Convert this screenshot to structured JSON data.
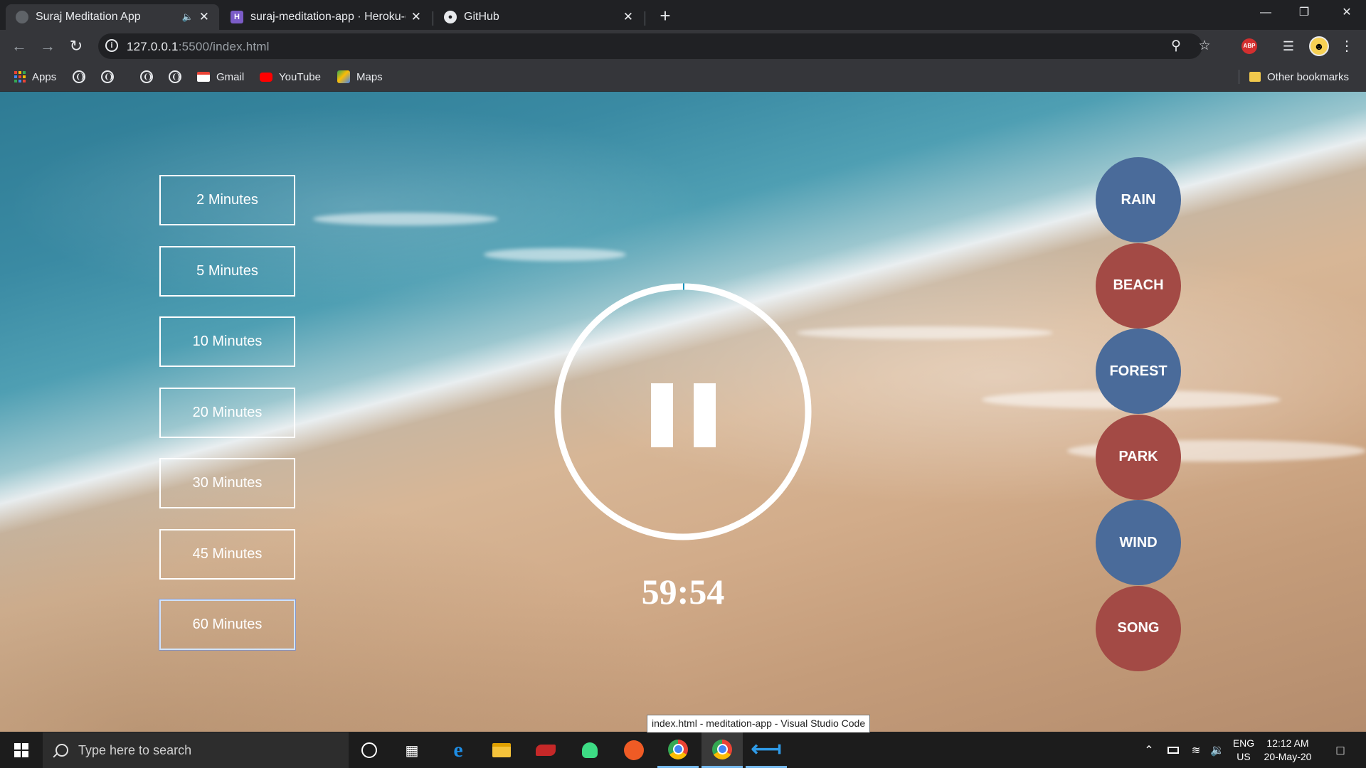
{
  "browser": {
    "tabs": [
      {
        "title": "Suraj Meditation App",
        "active": true,
        "audio": true
      },
      {
        "title": "suraj-meditation-app · Heroku-g",
        "active": false
      },
      {
        "title": "GitHub",
        "active": false
      }
    ],
    "url_host": "127.0.0.1",
    "url_rest": ":5500/index.html",
    "bookmarks": {
      "apps": "Apps",
      "gmail": "Gmail",
      "youtube": "YouTube",
      "maps": "Maps",
      "other": "Other bookmarks"
    }
  },
  "app": {
    "durations": [
      "2 Minutes",
      "5 Minutes",
      "10 Minutes",
      "20 Minutes",
      "30 Minutes",
      "45 Minutes",
      "60 Minutes"
    ],
    "selected_duration": "60 Minutes",
    "timer": "59:54",
    "progress_fraction": 0.0017,
    "state": "playing",
    "sounds": [
      {
        "label": "RAIN",
        "color": "#4a6b9a"
      },
      {
        "label": "BEACH",
        "color": "#a34a45"
      },
      {
        "label": "FOREST",
        "color": "#4a6b9a"
      },
      {
        "label": "PARK",
        "color": "#a34a45"
      },
      {
        "label": "WIND",
        "color": "#4a6b9a"
      },
      {
        "label": "SONG",
        "color": "#a34a45"
      }
    ]
  },
  "tooltip": "index.html - meditation-app - Visual Studio Code",
  "taskbar": {
    "search_placeholder": "Type here to search",
    "lang_line1": "ENG",
    "lang_line2": "US",
    "time": "12:12 AM",
    "date": "20-May-20"
  }
}
